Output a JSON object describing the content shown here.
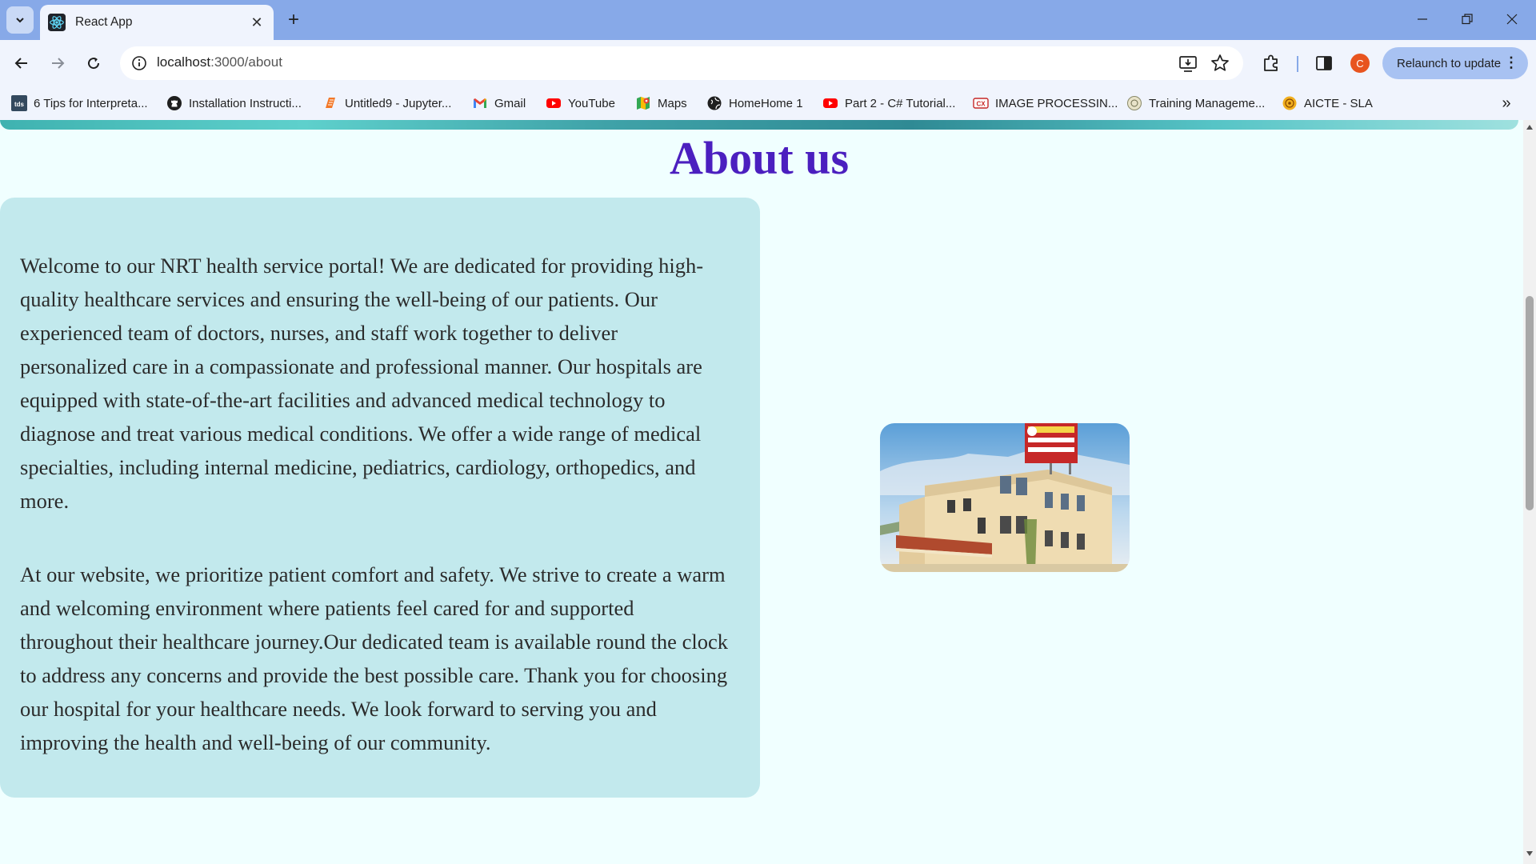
{
  "browser": {
    "tab_title": "React App",
    "url_host": "localhost",
    "url_path": ":3000/about",
    "profile_initial": "C",
    "relaunch_label": "Relaunch to update"
  },
  "bookmarks": [
    {
      "label": "6 Tips for Interpreta...",
      "icon": "tds-icon"
    },
    {
      "label": "Installation Instructi...",
      "icon": "github-icon"
    },
    {
      "label": "Untitled9 - Jupyter...",
      "icon": "jupyter-icon"
    },
    {
      "label": "Gmail",
      "icon": "gmail-icon"
    },
    {
      "label": "YouTube",
      "icon": "youtube-icon"
    },
    {
      "label": "Maps",
      "icon": "maps-icon"
    },
    {
      "label": "HomeHome 1",
      "icon": "globe-icon"
    },
    {
      "label": "Part 2 - C# Tutorial...",
      "icon": "youtube-icon"
    },
    {
      "label": "IMAGE PROCESSIN...",
      "icon": "image-processing-icon"
    },
    {
      "label": "Training Manageme...",
      "icon": "training-icon"
    },
    {
      "label": "AICTE - SLA",
      "icon": "aicte-icon"
    }
  ],
  "page": {
    "title": "About us",
    "paragraphs": [
      "Welcome to our NRT health service portal! We are dedicated for providing high-quality healthcare services and ensuring the well-being of our patients. Our experienced team of doctors, nurses, and staff work together to deliver personalized care in a compassionate and professional manner. Our hospitals are equipped with state-of-the-art facilities and advanced medical technology to diagnose and treat various medical conditions. We offer a wide range of medical specialties, including internal medicine, pediatrics, cardiology, orthopedics, and more.",
      "At our website, we prioritize patient comfort and safety. We strive to create a warm and welcoming environment where patients feel cared for and supported throughout their healthcare journey.Our dedicated team is available round the clock to address any concerns and provide the best possible care. Thank you for choosing our hospital for your healthcare needs. We look forward to serving you and improving the health and well-being of our community."
    ],
    "image_subject": "hospital-building-photo"
  },
  "colors": {
    "title": "#4b1fbf",
    "card_bg": "#c2e9ed",
    "page_bg": "#f0ffff",
    "tabbar_bg": "#87a9e8"
  }
}
